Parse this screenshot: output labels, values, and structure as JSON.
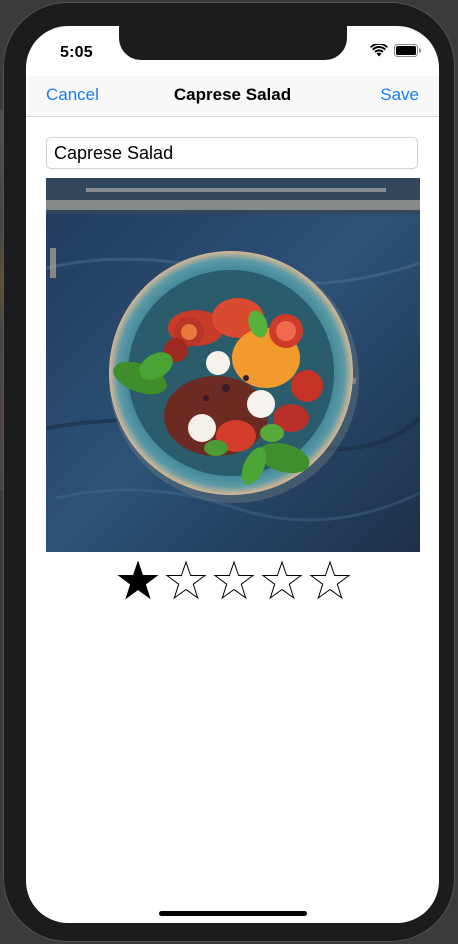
{
  "status_bar": {
    "time": "5:05",
    "icons": [
      "wifi-icon",
      "battery-icon"
    ]
  },
  "nav": {
    "cancel_label": "Cancel",
    "title": "Caprese Salad",
    "save_label": "Save"
  },
  "meal": {
    "name_value": "Caprese Salad",
    "photo_icon": "salad-photo",
    "rating": 1,
    "rating_max": 5
  },
  "colors": {
    "accent": "#1a7cf5",
    "star_filled": "#000000",
    "star_empty": "#ffffff",
    "star_outline": "#000000"
  }
}
